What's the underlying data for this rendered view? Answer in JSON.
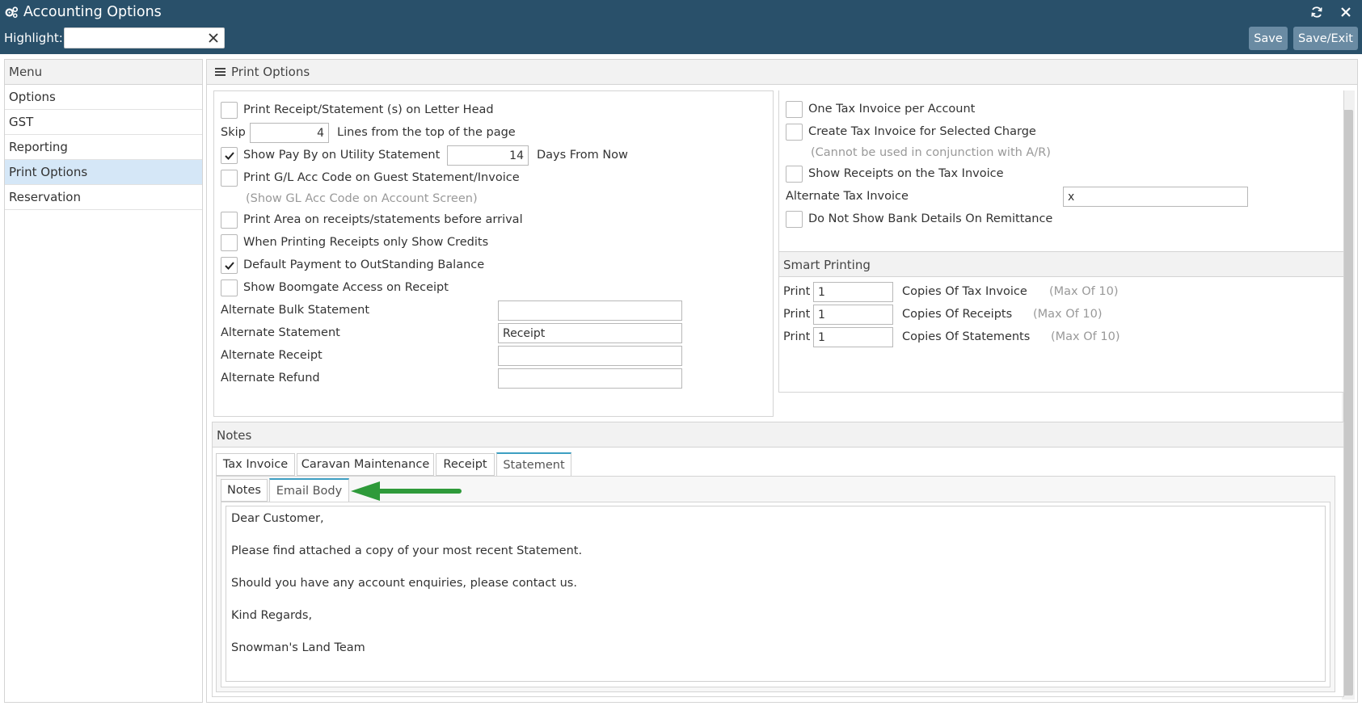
{
  "window": {
    "title": "Accounting Options"
  },
  "highlight": {
    "label": "Highlight:",
    "value": ""
  },
  "buttons": {
    "save": "Save",
    "save_exit": "Save/Exit"
  },
  "menu": {
    "header": "Menu",
    "items": [
      {
        "label": "Options"
      },
      {
        "label": "GST"
      },
      {
        "label": "Reporting"
      },
      {
        "label": "Print Options"
      },
      {
        "label": "Reservation"
      }
    ]
  },
  "panel": {
    "title": "Print Options"
  },
  "left_options": {
    "print_letterhead": {
      "label": "Print Receipt/Statement (s) on Letter Head",
      "checked": false
    },
    "skip": {
      "prefix": "Skip",
      "value": "4",
      "suffix": "Lines from the top of the page"
    },
    "show_pay_by": {
      "label": "Show Pay By on Utility Statement",
      "checked": true,
      "days_value": "14",
      "days_suffix": "Days From Now"
    },
    "print_gl_code": {
      "label": "Print G/L Acc Code on Guest Statement/Invoice",
      "checked": false,
      "hint": "(Show GL Acc Code on Account Screen)"
    },
    "print_area": {
      "label": "Print Area on receipts/statements before arrival",
      "checked": false
    },
    "only_credits": {
      "label": "When Printing Receipts only Show Credits",
      "checked": false
    },
    "default_payment": {
      "label": "Default Payment to OutStanding Balance",
      "checked": true
    },
    "boomgate": {
      "label": "Show Boomgate Access on Receipt",
      "checked": false
    },
    "alt_bulk_statement": {
      "label": "Alternate Bulk Statement",
      "value": ""
    },
    "alt_statement": {
      "label": "Alternate Statement",
      "value": "Receipt"
    },
    "alt_receipt": {
      "label": "Alternate Receipt",
      "value": ""
    },
    "alt_refund": {
      "label": "Alternate Refund",
      "value": ""
    }
  },
  "right_options": {
    "one_tax_invoice": {
      "label": "One Tax Invoice per Account",
      "checked": false
    },
    "tax_invoice_selected": {
      "label": "Create Tax Invoice for Selected Charge",
      "checked": false,
      "hint": "(Cannot be used in conjunction with A/R)"
    },
    "show_receipts": {
      "label": "Show Receipts on the Tax Invoice",
      "checked": false
    },
    "alt_tax_invoice": {
      "label": "Alternate Tax Invoice",
      "value": "x"
    },
    "no_bank_details": {
      "label": "Do Not Show Bank Details On Remittance",
      "checked": false
    }
  },
  "smart_printing": {
    "title": "Smart Printing",
    "rows": [
      {
        "prefix": "Print",
        "value": "1",
        "label": "Copies Of Tax Invoice",
        "max": "(Max Of 10)"
      },
      {
        "prefix": "Print",
        "value": "1",
        "label": "Copies Of Receipts",
        "max": "(Max Of 10)"
      },
      {
        "prefix": "Print",
        "value": "1",
        "label": "Copies Of Statements",
        "max": "(Max Of 10)"
      }
    ]
  },
  "notes": {
    "title": "Notes",
    "tabs": [
      "Tax Invoice",
      "Caravan Maintenance",
      "Receipt",
      "Statement"
    ],
    "selected_tab": "Statement",
    "subtabs": [
      "Notes",
      "Email Body"
    ],
    "selected_subtab": "Email Body",
    "email_body": [
      "Dear Customer,",
      "Please find attached a copy of your most recent Statement.",
      "Should you have any account enquiries, please contact us.",
      "Kind Regards,",
      "Snowman's Land Team"
    ]
  },
  "colors": {
    "titlebar": "#29506a",
    "button": "#6a8ba3",
    "selected_menu": "#d5e7f7",
    "tab_accent": "#3d9fc2",
    "annotation_arrow": "#2e9a3a"
  }
}
